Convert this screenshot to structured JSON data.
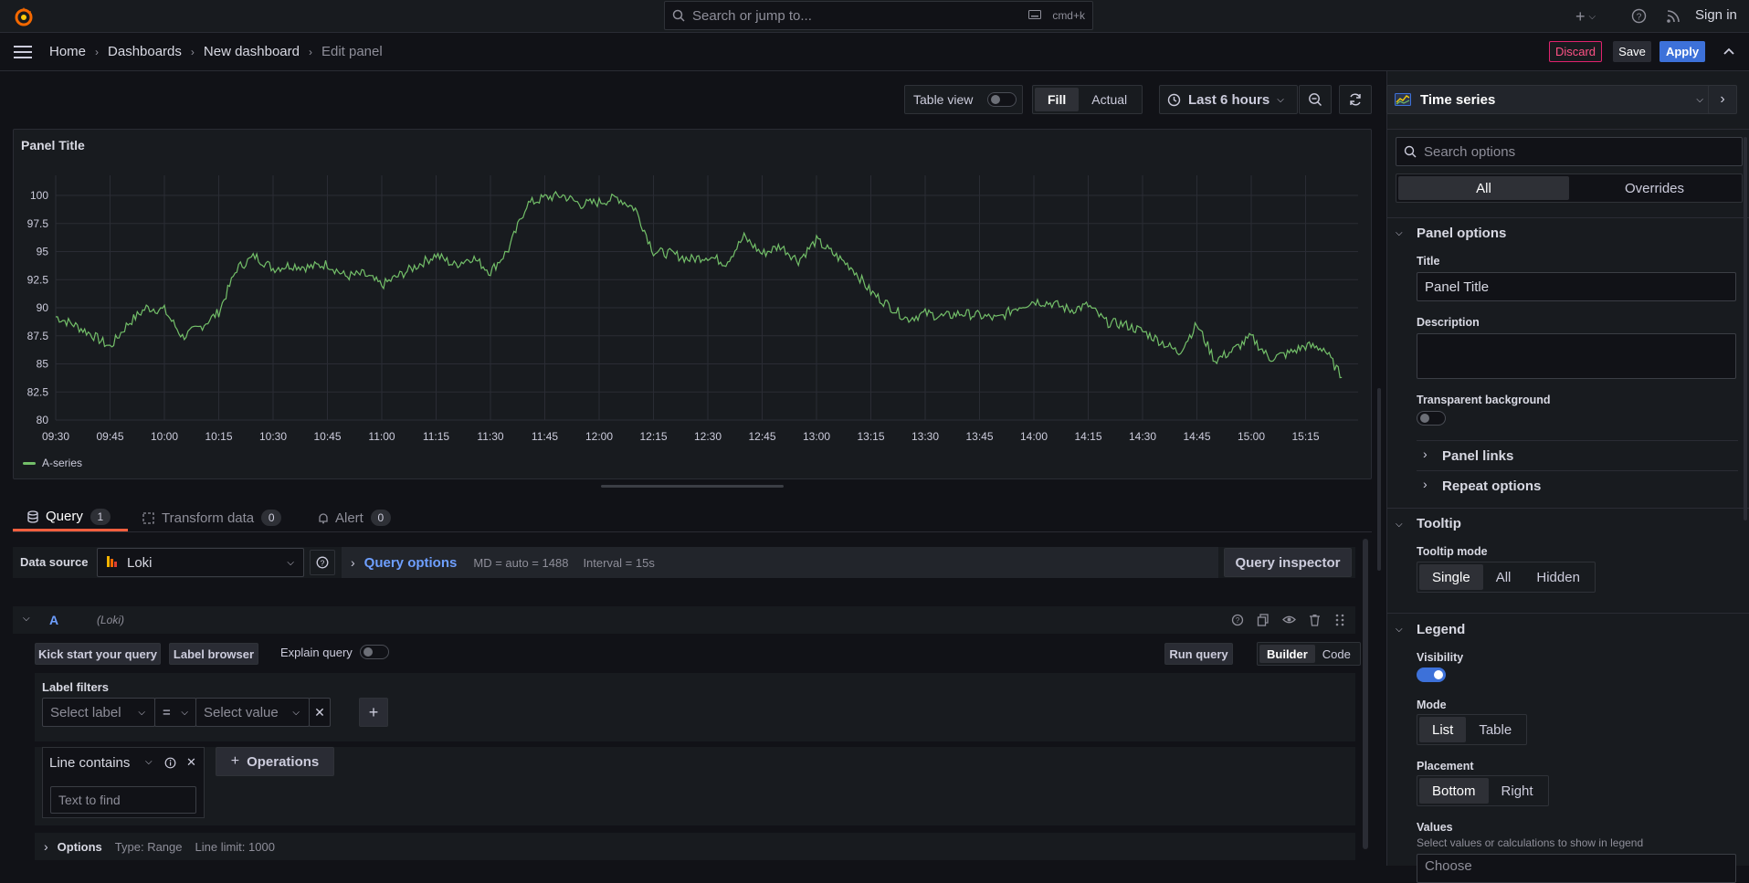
{
  "topbar": {
    "search_placeholder": "Search or jump to...",
    "shortcut": "cmd+k",
    "sign_in": "Sign in"
  },
  "breadcrumb": [
    "Home",
    "Dashboards",
    "New dashboard",
    "Edit panel"
  ],
  "actions": {
    "discard": "Discard",
    "save": "Save",
    "apply": "Apply"
  },
  "toolbar": {
    "table_view": "Table view",
    "fill": "Fill",
    "actual": "Actual",
    "time_range": "Last 6 hours"
  },
  "panel": {
    "title": "Panel Title"
  },
  "chart_data": {
    "type": "line",
    "x": [
      "09:30",
      "09:45",
      "10:00",
      "10:15",
      "10:30",
      "10:45",
      "11:00",
      "11:15",
      "11:30",
      "11:45",
      "12:00",
      "12:15",
      "12:30",
      "12:45",
      "13:00",
      "13:15",
      "13:30",
      "13:45",
      "14:00",
      "14:15",
      "14:30",
      "14:45",
      "15:00",
      "15:15"
    ],
    "x_extended": [
      "09:30",
      "09:35",
      "09:40",
      "09:45",
      "09:50",
      "09:55",
      "10:00",
      "10:05",
      "10:10",
      "10:15",
      "10:20",
      "10:25",
      "10:30",
      "10:35",
      "10:40",
      "10:45",
      "10:50",
      "10:55",
      "11:00",
      "11:05",
      "11:10",
      "11:15",
      "11:20",
      "11:25",
      "11:30",
      "11:35",
      "11:40",
      "11:45",
      "11:50",
      "11:55",
      "12:00",
      "12:05",
      "12:10",
      "12:15",
      "12:20",
      "12:25",
      "12:30",
      "12:35",
      "12:40",
      "12:45",
      "12:50",
      "12:55",
      "13:00",
      "13:05",
      "13:10",
      "13:15",
      "13:20",
      "13:25",
      "13:30",
      "13:35",
      "13:40",
      "13:45",
      "13:50",
      "13:55",
      "14:00",
      "14:05",
      "14:10",
      "14:15",
      "14:20",
      "14:25",
      "14:30",
      "14:35",
      "14:40",
      "14:45",
      "14:50",
      "14:55",
      "15:00",
      "15:05",
      "15:10",
      "15:15",
      "15:20",
      "15:25"
    ],
    "series": [
      {
        "name": "A-series",
        "color": "#73bf69",
        "values": [
          89.2,
          88.5,
          87.6,
          86.5,
          88.6,
          90.0,
          89.8,
          87.4,
          88.3,
          89.6,
          93.5,
          94.6,
          93.5,
          93.8,
          93.6,
          93.9,
          92.8,
          93.0,
          92.0,
          92.9,
          93.8,
          94.7,
          93.8,
          94.5,
          93.2,
          95.2,
          99.2,
          99.8,
          100.0,
          99.2,
          99.4,
          99.8,
          98.8,
          95.0,
          94.8,
          94.3,
          94.6,
          94.0,
          96.3,
          94.8,
          95.5,
          94.2,
          96.0,
          94.7,
          93.5,
          91.4,
          90.2,
          89.0,
          89.5,
          89.2,
          89.5,
          89.3,
          89.0,
          90.0,
          90.6,
          90.4,
          89.8,
          90.2,
          88.7,
          88.5,
          87.9,
          87.0,
          86.0,
          88.5,
          85.3,
          86.2,
          87.4,
          85.5,
          85.9,
          86.6,
          86.4,
          83.8
        ]
      }
    ],
    "ylim": [
      80,
      100
    ],
    "yticks": [
      "100",
      "97.5",
      "95",
      "92.5",
      "90",
      "87.5",
      "85",
      "82.5",
      "80"
    ],
    "legend": "bottom-left",
    "grid": true
  },
  "query_tabs": [
    {
      "label": "Query",
      "count": "1"
    },
    {
      "label": "Transform data",
      "count": "0"
    },
    {
      "label": "Alert",
      "count": "0"
    }
  ],
  "datasource": {
    "label": "Data source",
    "value": "Loki",
    "query_options": "Query options",
    "md": "MD = auto = 1488",
    "interval": "Interval = 15s",
    "inspector": "Query inspector"
  },
  "query_row": {
    "ref": "A",
    "ds": "(Loki)",
    "kick_start": "Kick start your query",
    "label_browser": "Label browser",
    "explain": "Explain query",
    "run_query": "Run query",
    "builder": "Builder",
    "code": "Code",
    "label_filters": "Label filters",
    "select_label": "Select label",
    "operator": "=",
    "select_value": "Select value",
    "line_contains": "Line contains",
    "text_placeholder": "Text to find",
    "operations": "Operations",
    "options": "Options",
    "options_type": "Type: Range",
    "options_limit": "Line limit: 1000"
  },
  "options_pane": {
    "viz": "Time series",
    "search_placeholder": "Search options",
    "tab_all": "All",
    "tab_overrides": "Overrides",
    "panel_options": "Panel options",
    "title_label": "Title",
    "title_value": "Panel Title",
    "description_label": "Description",
    "transparent_label": "Transparent background",
    "panel_links": "Panel links",
    "repeat_options": "Repeat options",
    "tooltip": "Tooltip",
    "tooltip_mode": "Tooltip mode",
    "tooltip_modes": [
      "Single",
      "All",
      "Hidden"
    ],
    "legend": "Legend",
    "visibility": "Visibility",
    "mode": "Mode",
    "modes": [
      "List",
      "Table"
    ],
    "placement": "Placement",
    "placements": [
      "Bottom",
      "Right"
    ],
    "values": "Values",
    "values_hint": "Select values or calculations to show in legend",
    "values_placeholder": "Choose"
  },
  "colors": {
    "accent": "#3d71d9",
    "series": "#73bf69",
    "discard": "#e0226e",
    "tab_active": "#f55f3e"
  }
}
